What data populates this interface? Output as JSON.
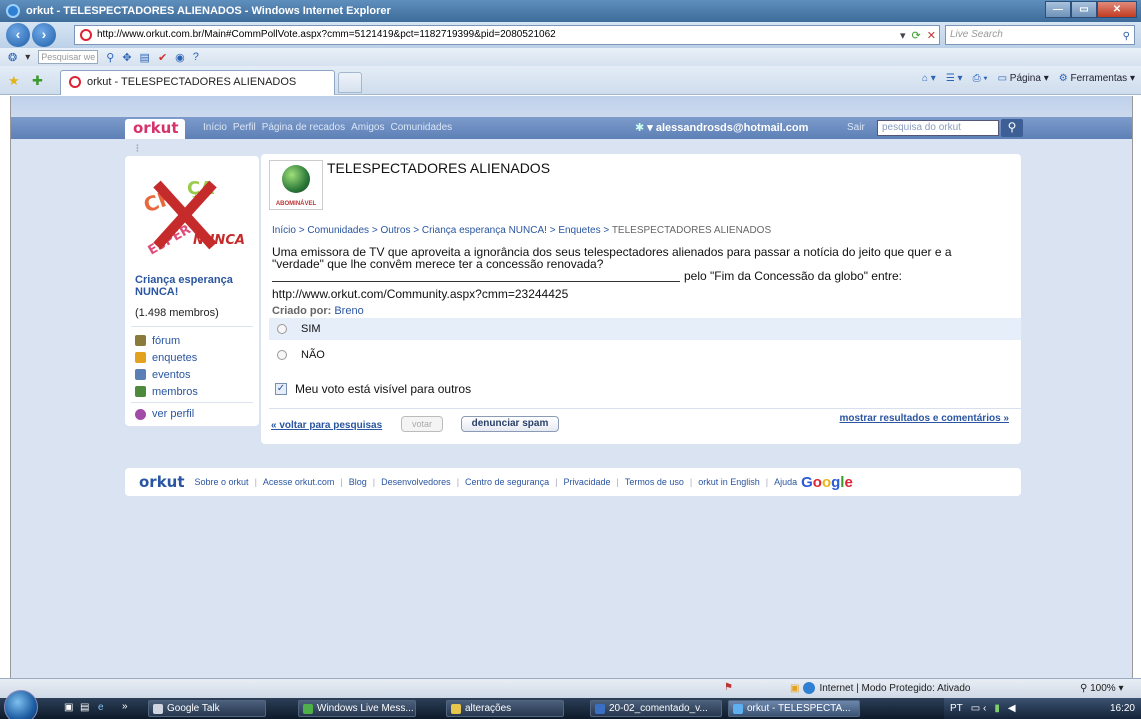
{
  "window": {
    "title": "orkut - TELESPECTADORES ALIENADOS - Windows Internet Explorer"
  },
  "browser": {
    "url": "http://www.orkut.com.br/Main#CommPollVote.aspx?cmm=5121419&pct=1182719399&pid=2080521062",
    "live_search_placeholder": "Live Search",
    "toolbar_search_placeholder": "Pesquisar we",
    "tab_title": "orkut - TELESPECTADORES ALIENADOS",
    "cmd_pagina": "Página",
    "cmd_ferramentas": "Ferramentas"
  },
  "orkut": {
    "logo": "orkut",
    "nav": [
      "Início",
      "Perfil",
      "Página de recados",
      "Amigos",
      "Comunidades"
    ],
    "user_email": "alessandrosds@hotmail.com",
    "sair": "Sair",
    "search_placeholder": "pesquisa do orkut"
  },
  "community": {
    "name": "Criança esperança NUNCA!",
    "members": "(1.498 membros)",
    "image_text": "NUNCA!!",
    "menu": [
      {
        "label": "fórum",
        "color": "#8a7a3c"
      },
      {
        "label": "enquetes",
        "color": "#e2a21d"
      },
      {
        "label": "eventos",
        "color": "#5a7fb6"
      },
      {
        "label": "membros",
        "color": "#4b8b3b"
      }
    ],
    "ver_perfil": "ver perfil"
  },
  "poll": {
    "title": "TELESPECTADORES ALIENADOS",
    "badge": "ABOMINÁVEL",
    "breadcrumb": {
      "inicio": "Início",
      "comunidades": "Comunidades",
      "outros": "Outros",
      "community": "Criança esperança NUNCA!",
      "enquetes": "Enquetes",
      "current": "TELESPECTADORES ALIENADOS",
      "sep": ">"
    },
    "question_line1": "Uma emissora de TV que aproveita a ignorância dos seus telespectadores alienados para passar a notícia do jeito que quer e a",
    "question_line2": "\"verdade\" que lhe convêm merece ter a concessão renovada?",
    "question_line3": "pelo \"Fim da Concessão da globo\" entre:",
    "question_url": "http://www.orkut.com/Community.aspx?cmm=23244425",
    "created_by_label": "Criado por:",
    "created_by": "Breno",
    "options": [
      "SIM",
      "NÃO"
    ],
    "visibility": "Meu voto está visível para outros",
    "back_link": "« voltar para pesquisas",
    "vote_button": "votar",
    "spam_button": "denunciar spam",
    "results_link": "mostrar resultados e comentários »"
  },
  "footer": {
    "logo": "orkut",
    "links": [
      "Sobre o orkut",
      "Acesse orkut.com",
      "Blog",
      "Desenvolvedores",
      "Centro de segurança",
      "Privacidade",
      "Termos de uso",
      "orkut in English",
      "Ajuda"
    ],
    "google": "Google"
  },
  "status": {
    "zone": "Internet | Modo Protegido: Ativado",
    "zoom": "100%"
  },
  "taskbar": {
    "tasks": [
      "Google Talk",
      "Windows Live Mess...",
      "alterações",
      "20-02_comentado_v...",
      "orkut - TELESPECTA..."
    ],
    "lang": "PT",
    "clock": "16:20"
  }
}
